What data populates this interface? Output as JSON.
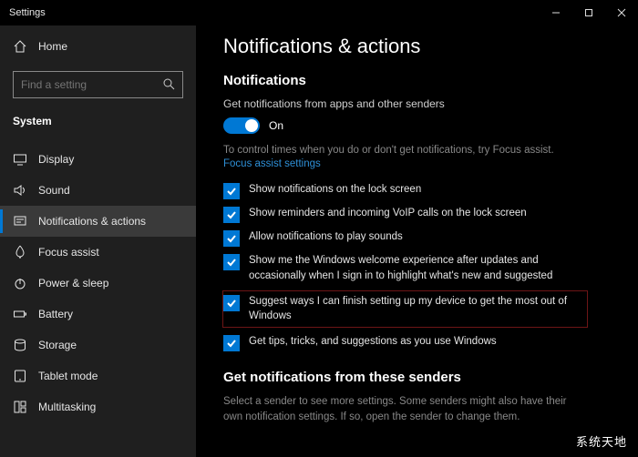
{
  "window": {
    "title": "Settings"
  },
  "sidebar": {
    "home": "Home",
    "searchPlaceholder": "Find a setting",
    "section": "System",
    "items": [
      {
        "label": "Display"
      },
      {
        "label": "Sound"
      },
      {
        "label": "Notifications & actions"
      },
      {
        "label": "Focus assist"
      },
      {
        "label": "Power & sleep"
      },
      {
        "label": "Battery"
      },
      {
        "label": "Storage"
      },
      {
        "label": "Tablet mode"
      },
      {
        "label": "Multitasking"
      }
    ]
  },
  "main": {
    "heading": "Notifications & actions",
    "notifHeading": "Notifications",
    "notifDesc": "Get notifications from apps and other senders",
    "toggleState": "On",
    "focusText": "To control times when you do or don't get notifications, try Focus assist.",
    "focusLink": "Focus assist settings",
    "checks": [
      "Show notifications on the lock screen",
      "Show reminders and incoming VoIP calls on the lock screen",
      "Allow notifications to play sounds",
      "Show me the Windows welcome experience after updates and occasionally when I sign in to highlight what's new and suggested",
      "Suggest ways I can finish setting up my device to get the most out of Windows",
      "Get tips, tricks, and suggestions as you use Windows"
    ],
    "sendersHeading": "Get notifications from these senders",
    "sendersDesc": "Select a sender to see more settings. Some senders might also have their own notification settings. If so, open the sender to change them."
  },
  "watermark": "系统天地"
}
